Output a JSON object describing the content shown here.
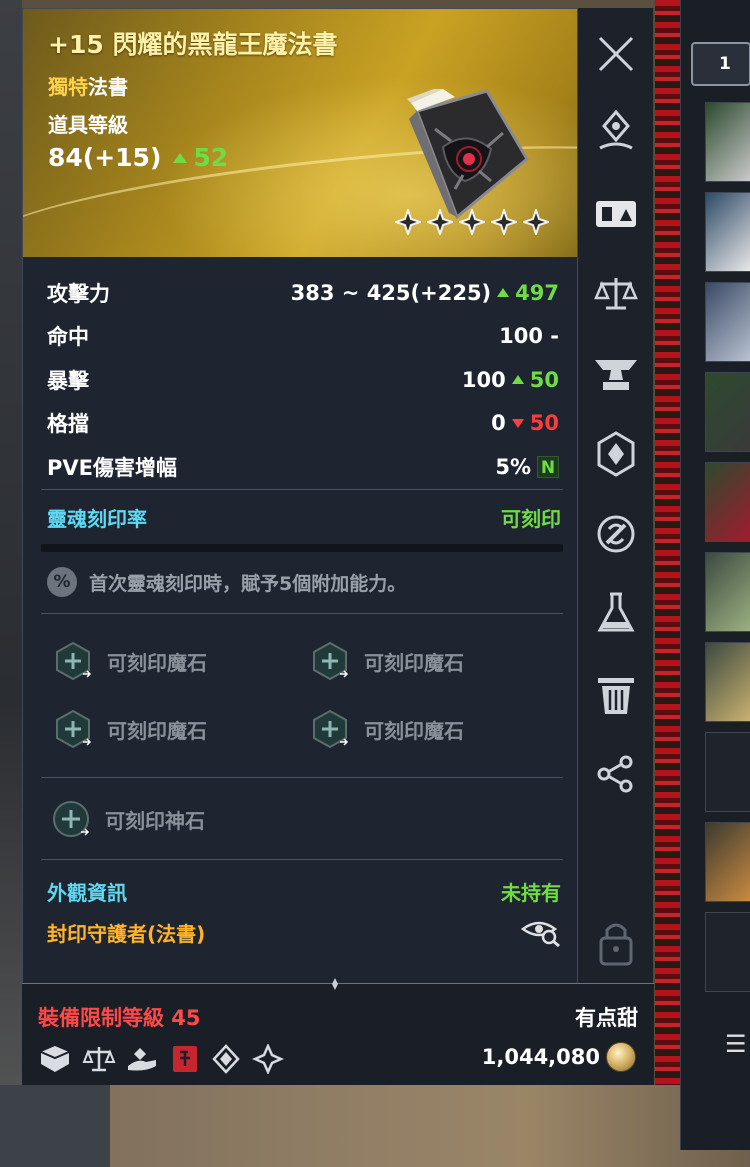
{
  "item": {
    "title": "+15 閃耀的黑龍王魔法書",
    "type_highlight": "獨特",
    "type_rest": "法書",
    "level_label": "道具等級",
    "level_value": "84(+15)",
    "level_diff": "52"
  },
  "stats": [
    {
      "label": "攻擊力",
      "value": "383 ~ 425(+225)",
      "diff": "497",
      "diff_dir": "up"
    },
    {
      "label": "命中",
      "value": "100 -",
      "diff": "",
      "diff_dir": "none"
    },
    {
      "label": "暴擊",
      "value": "100",
      "diff": "50",
      "diff_dir": "up"
    },
    {
      "label": "格擋",
      "value": "0",
      "diff": "50",
      "diff_dir": "down"
    },
    {
      "label": "PVE傷害增幅",
      "value": "5%",
      "diff": "N",
      "diff_dir": "new"
    }
  ],
  "soul": {
    "label": "靈魂刻印率",
    "status": "可刻印",
    "note": "首次靈魂刻印時，賦予5個附加能力。",
    "note_icon": "%"
  },
  "sockets": {
    "manastone_label": "可刻印魔石",
    "godstone_label": "可刻印神石"
  },
  "appearance": {
    "label": "外觀資訊",
    "status": "未持有",
    "skin_name": "封印守護者(法書)"
  },
  "footer": {
    "req_level": "裝備限制等級 45",
    "seller": "有点甜",
    "price": "1,044,080"
  },
  "inventory": {
    "tab_label": "1"
  },
  "colors": {
    "header_gold": "#c9a223",
    "title": "#fff2a8",
    "unique": "#ffd34a",
    "up": "#6fdc46",
    "down": "#ff3c3c",
    "cyan": "#5fd8f2",
    "orange": "#ffb42a",
    "req_red": "#ff4848"
  },
  "rail_icons": [
    "close-icon",
    "location-pin-icon",
    "compare-icon",
    "scale-icon",
    "anvil-icon",
    "enchant-icon",
    "soul-bind-icon",
    "potion-icon",
    "trash-icon",
    "share-icon",
    "lock-icon"
  ],
  "footer_icons": [
    "cube-icon",
    "trade-scale-icon",
    "hand-give-icon",
    "book-bind-icon",
    "dual-diamond-icon",
    "sparkle-diamond-icon"
  ]
}
